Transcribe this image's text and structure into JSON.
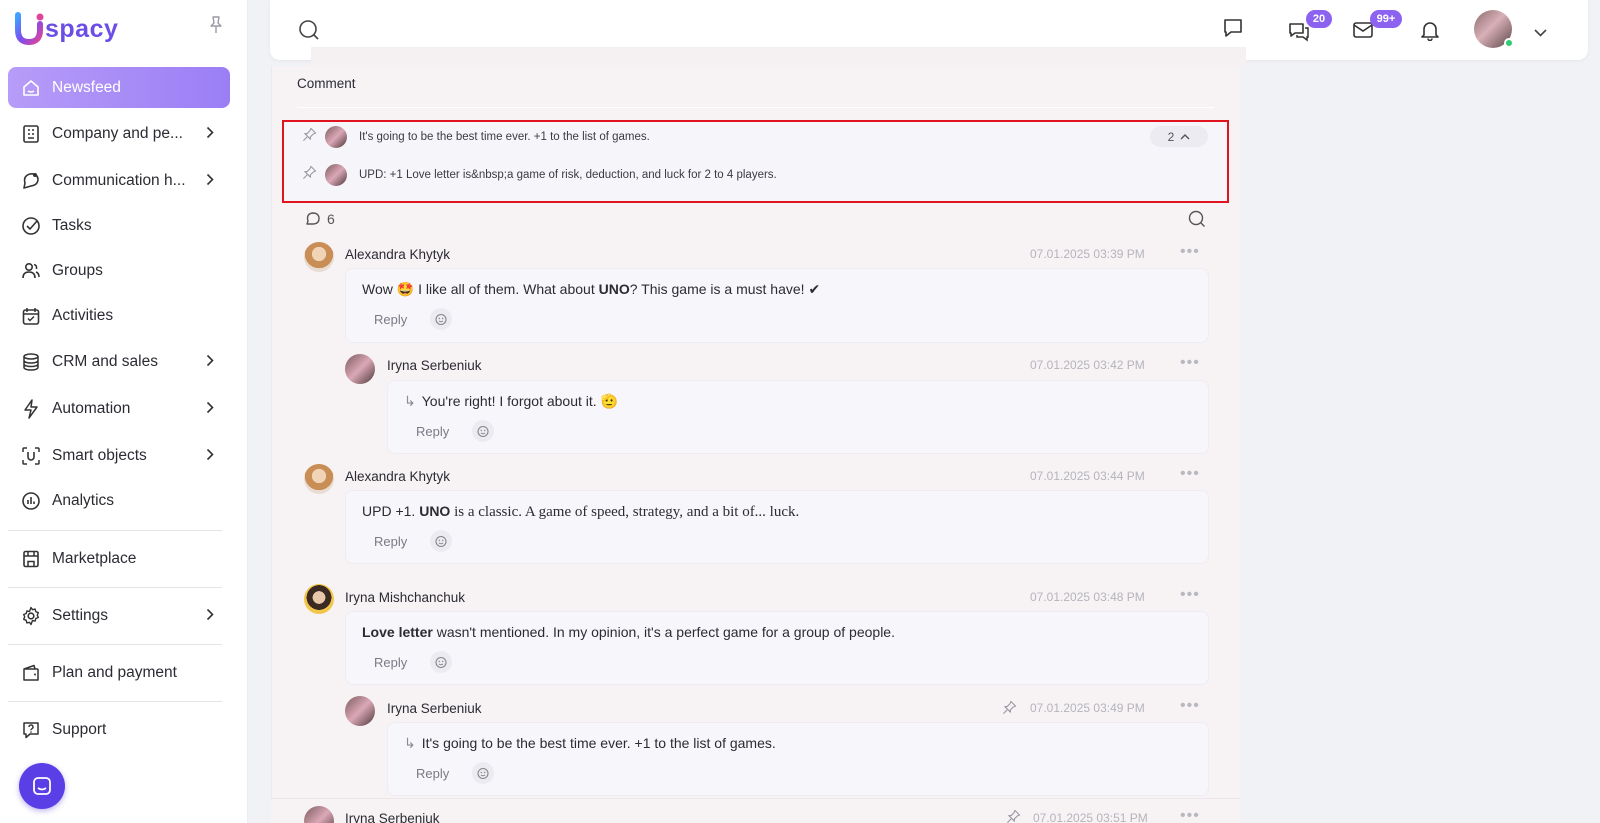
{
  "app": {
    "logo_text": "spacy",
    "logo_letter": "U"
  },
  "sidebar": {
    "items": [
      {
        "label": "Newsfeed",
        "icon": "home-icon",
        "active": true
      },
      {
        "label": "Company and pe...",
        "icon": "building-icon",
        "chevron": true
      },
      {
        "label": "Communication h...",
        "icon": "chat-hub-icon",
        "chevron": true
      },
      {
        "label": "Tasks",
        "icon": "check-circle-icon"
      },
      {
        "label": "Groups",
        "icon": "users-icon"
      },
      {
        "label": "Activities",
        "icon": "calendar-icon"
      },
      {
        "label": "CRM and sales",
        "icon": "database-icon",
        "chevron": true
      },
      {
        "label": "Automation",
        "icon": "lightning-icon",
        "chevron": true
      },
      {
        "label": "Smart objects",
        "icon": "smart-object-icon",
        "chevron": true
      },
      {
        "label": "Analytics",
        "icon": "chart-icon"
      },
      {
        "label": "Marketplace",
        "icon": "store-icon"
      },
      {
        "label": "Settings",
        "icon": "gear-icon",
        "chevron": true
      },
      {
        "label": "Plan and payment",
        "icon": "wallet-icon"
      },
      {
        "label": "Support",
        "icon": "question-icon"
      }
    ]
  },
  "topbar": {
    "messages_badge": "20",
    "mail_badge": "99+"
  },
  "feed": {
    "section_title": "Comment",
    "pinned": [
      {
        "text": "It's going to be the best time ever. +1 to the list of games."
      },
      {
        "text": "UPD: +1 Love letter is&nbsp;a game of risk, deduction, and luck for 2 to 4 players."
      }
    ],
    "pinned_count": "2",
    "comments_count": "6",
    "reply_label": "Reply",
    "comments": [
      {
        "author": "Alexandra Khytyk",
        "date": "07.01.2025 03:39 PM",
        "pre": "Wow 🤩 I like all of them. What about ",
        "bold": "UNO",
        "post": "? This game is a must have! ✔"
      },
      {
        "author": "Iryna Serbeniuk",
        "date": "07.01.2025 03:42 PM",
        "text": "You're right! I forgot about it. 🫡"
      },
      {
        "author": "Alexandra Khytyk",
        "date": "07.01.2025 03:44 PM",
        "pre": "UPD +1. ",
        "bold": "UNO",
        "post": " is a classic. A game of speed, strategy, and a bit of... luck."
      },
      {
        "author": "Iryna Mishchanchuk",
        "date": "07.01.2025 03:48 PM",
        "bold": "Love letter",
        "post": " wasn't mentioned. In my opinion, it's a perfect game for a group of people."
      },
      {
        "author": "Iryna Serbeniuk",
        "date": "07.01.2025 03:49 PM",
        "text": "It's going to be the best time ever. +1 to the list of games."
      },
      {
        "author": "Iryna Serbeniuk",
        "date": "07.01.2025 03:51 PM"
      }
    ]
  },
  "colors": {
    "accent": "#8b63f0",
    "highlight_border": "#e0141e",
    "fab": "#5a3ee6"
  }
}
